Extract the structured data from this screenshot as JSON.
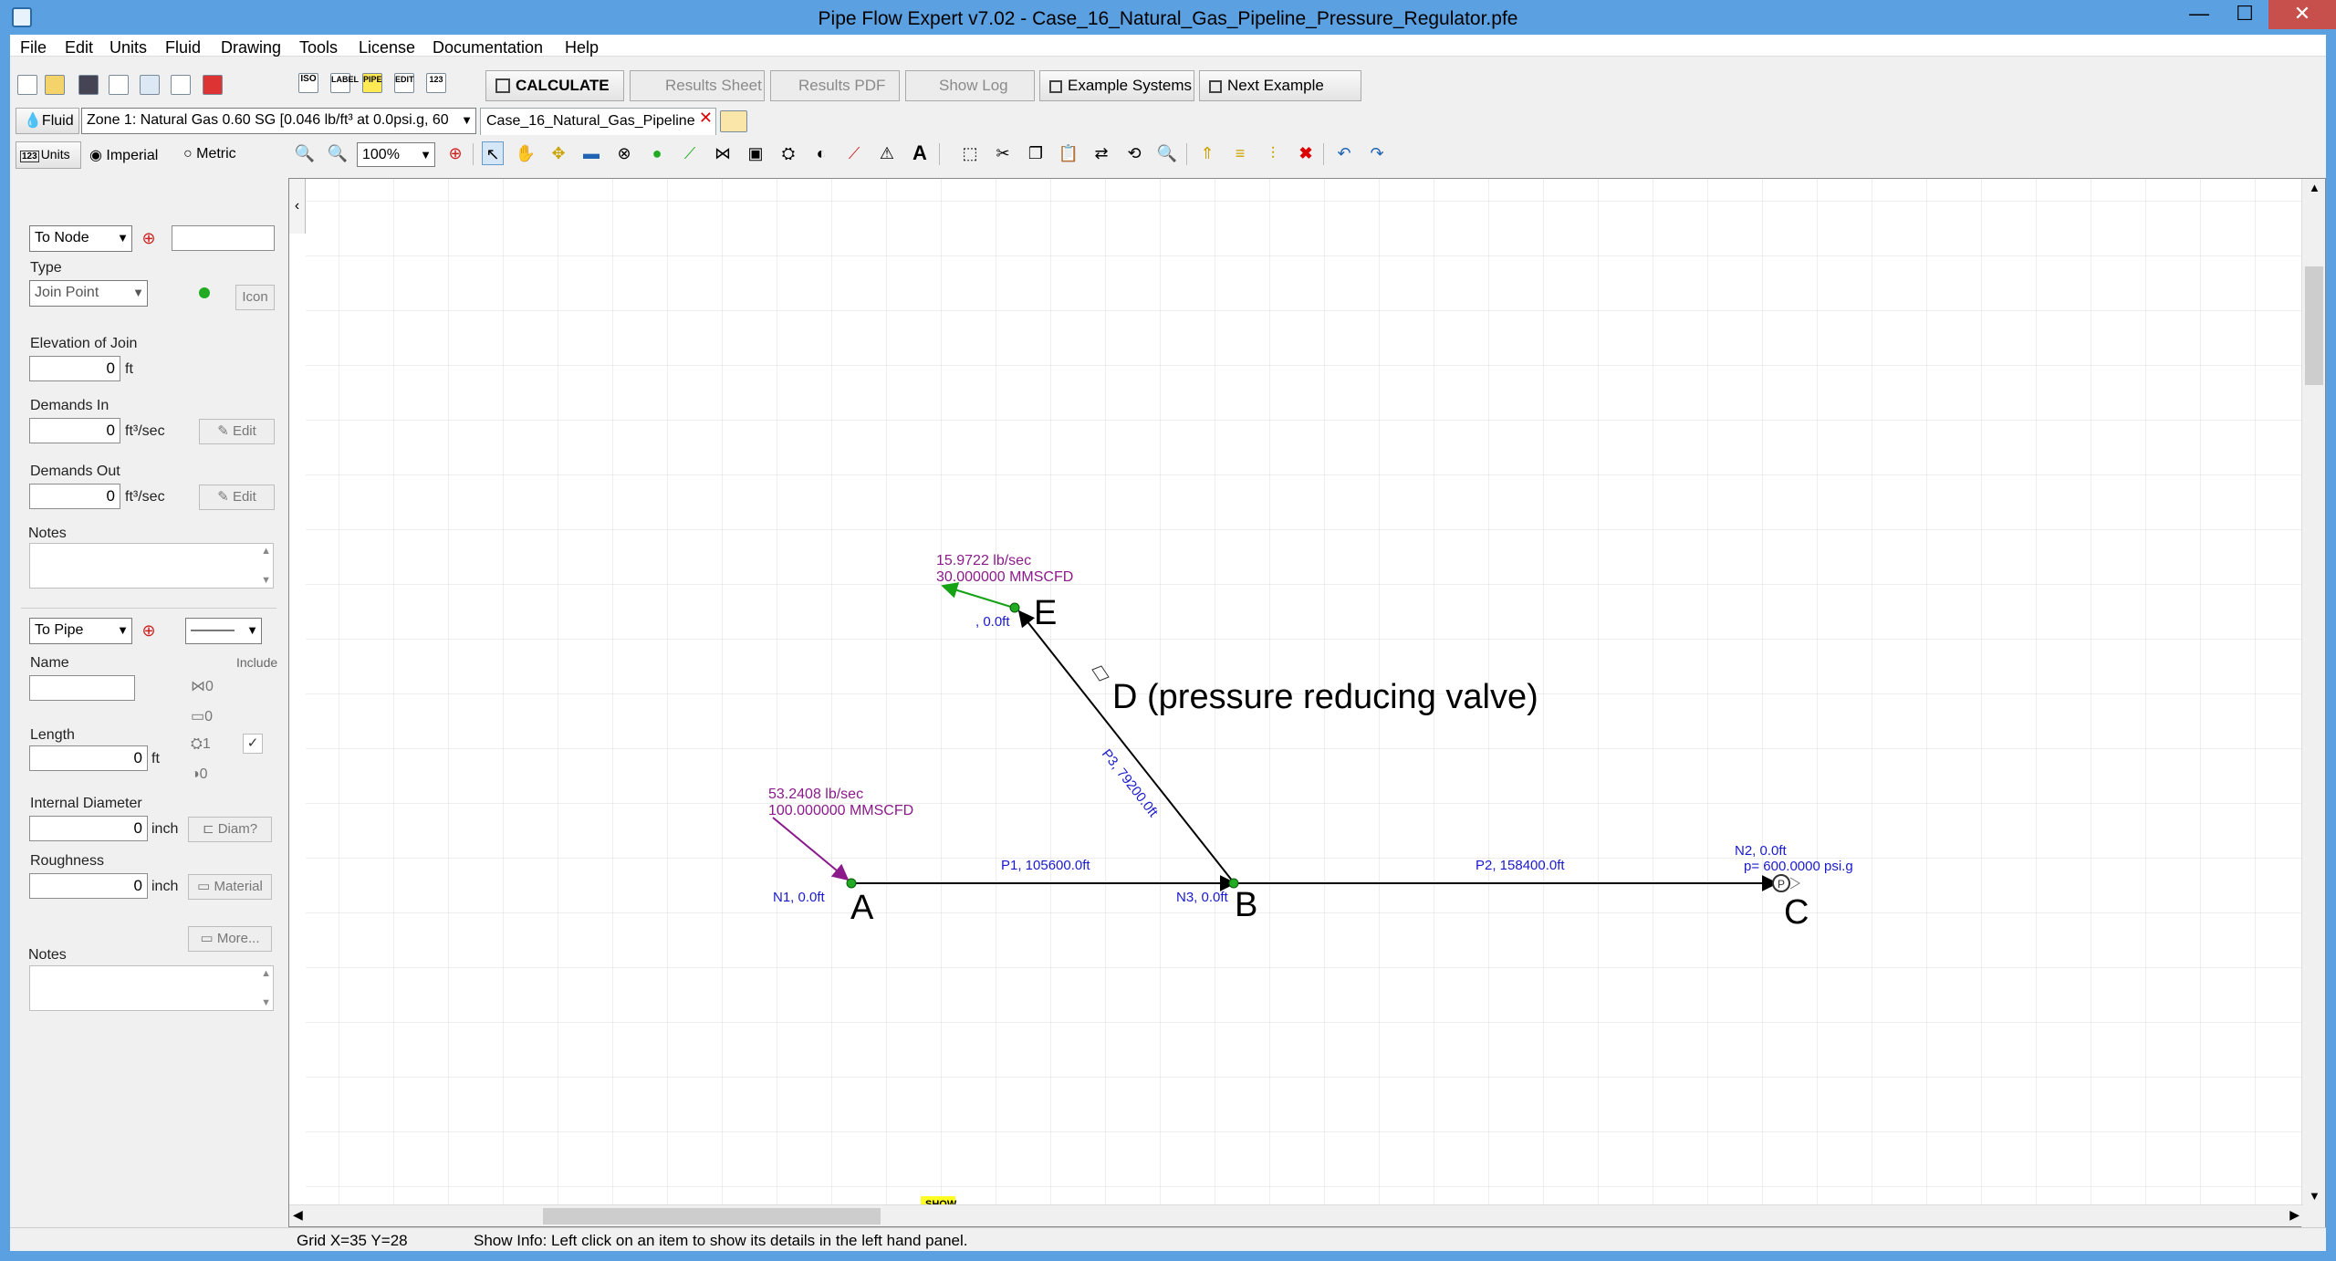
{
  "window": {
    "title": "Pipe Flow Expert v7.02 - Case_16_Natural_Gas_Pipeline_Pressure_Regulator.pfe",
    "minimize": "—",
    "maximize": "☐",
    "close": "✕"
  },
  "menu": [
    "File",
    "Edit",
    "Units",
    "Fluid",
    "Drawing",
    "Tools",
    "License",
    "Documentation",
    "Help"
  ],
  "toolbar": {
    "calculate": "CALCULATE",
    "results_sheet": "Results Sheet",
    "results_pdf": "Results PDF",
    "show_log": "Show Log",
    "example_systems": "Example Systems",
    "next_example": "Next Example"
  },
  "toolbar_small_labels": [
    "ISO",
    "LABEL",
    "PIPE",
    "EDIT",
    "123"
  ],
  "fluid": {
    "label": "Fluid",
    "zone": "Zone 1: Natural Gas 0.60 SG [0.046 lb/ft³ at 0.0psi.g, 60"
  },
  "doc_tab": {
    "label": "Case_16_Natural_Gas_Pipeline",
    "close": "✕"
  },
  "units": {
    "label": "Units",
    "icon_text": "123",
    "imperial": "Imperial",
    "metric": "Metric"
  },
  "zoom": {
    "value": "100%"
  },
  "node_panel": {
    "selector": "To Node",
    "type_label": "Type",
    "type_value": "Join Point",
    "icon_button": "Icon",
    "elevation_label": "Elevation of Join",
    "elevation_value": "0",
    "elevation_unit": "ft",
    "demands_in_label": "Demands In",
    "demands_in_value": "0",
    "demands_in_unit": "ft³/sec",
    "demands_out_label": "Demands Out",
    "demands_out_value": "0",
    "demands_out_unit": "ft³/sec",
    "edit": "Edit",
    "notes_label": "Notes"
  },
  "pipe_panel": {
    "selector": "To Pipe",
    "name_label": "Name",
    "include_label": "Include",
    "length_label": "Length",
    "length_value": "0",
    "length_unit": "ft",
    "diameter_label": "Internal Diameter",
    "diameter_value": "0",
    "diameter_unit": "inch",
    "diam_button": "Diam?",
    "roughness_label": "Roughness",
    "roughness_value": "0",
    "roughness_unit": "inch",
    "material_button": "Material",
    "more_button": "More...",
    "notes_label": "Notes",
    "count_fittings": "0",
    "count_components": "0",
    "count_pumps": "1",
    "count_valves": "0",
    "include_checked": "✓"
  },
  "diagram": {
    "nodes": [
      {
        "letter": "A",
        "label": "N1, 0.0ft"
      },
      {
        "letter": "B",
        "label": "N3, 0.0ft"
      },
      {
        "letter": "C",
        "label": "N2, 0.0ft",
        "pressure": "p= 600.0000 psi.g"
      },
      {
        "letter": "E",
        "label": ", 0.0ft"
      }
    ],
    "pipes": [
      {
        "label": "P1, 105600.0ft"
      },
      {
        "label": "P2, 158400.0ft"
      },
      {
        "label": "P3, 79200.0ft"
      }
    ],
    "inflow": {
      "mass": "53.2408 lb/sec",
      "vol": "100.000000 MMSCFD"
    },
    "outflow": {
      "mass": "15.9722 lb/sec",
      "vol": "30.000000 MMSCFD"
    },
    "valve_label": "D (pressure reducing valve)",
    "show_badge": "SHOW"
  },
  "status": {
    "grid": "Grid  X=35  Y=28",
    "info": "Show Info: Left click on an item to show its details in the left hand panel."
  },
  "colors": {
    "node": "#22aa22",
    "flow": "#8b1a8b",
    "outflow": "#15a215",
    "label_blue": "#1a1acd",
    "grid": "#dcdcdc",
    "titlebar": "#5ba0e0"
  }
}
